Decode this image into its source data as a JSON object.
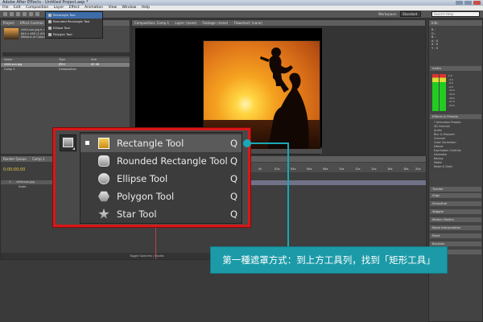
{
  "window": {
    "title": "Adobe After Effects - Untitled Project.aep *"
  },
  "menu": [
    "File",
    "Edit",
    "Composition",
    "Layer",
    "Effect",
    "Animation",
    "View",
    "Window",
    "Help"
  ],
  "toolbar": {
    "workspace_label": "Workspace:",
    "workspace_value": "Standard",
    "search_placeholder": "Search Help"
  },
  "project_panel": {
    "tabs": [
      "Project",
      "Effect Controls"
    ],
    "file_name": "child-sun.jpg",
    "file_info": [
      "child-sun.jpg ▾, used",
      "640 x 480 (1.00)",
      "Millions of Colors"
    ],
    "columns": [
      "Name",
      "Type",
      "Size"
    ],
    "rows": [
      {
        "name": "child-sun.jpg",
        "type": "JPEG",
        "size": "89 KB",
        "selected": true
      },
      {
        "name": "Comp 1",
        "type": "Composition",
        "size": "",
        "selected": false
      }
    ]
  },
  "small_menu": {
    "items": [
      {
        "label": "Rectangle Tool",
        "highlight": true
      },
      {
        "label": "Rounded Rectangle Tool",
        "highlight": false
      },
      {
        "label": "Ellipse Tool",
        "highlight": false
      },
      {
        "label": "Polygon Tool",
        "highlight": false
      },
      {
        "label": "Star Tool",
        "highlight": false
      }
    ]
  },
  "composition_panel": {
    "tabs": [
      "Composition: Comp 1",
      "Layer: (none)",
      "Footage: (none)",
      "Flowchart: (none)"
    ]
  },
  "right_panels": {
    "info_lines": [
      "R :",
      "G :",
      "B :",
      "A : 0",
      "X : 0",
      "Y : 0"
    ],
    "audio_label": "Audio",
    "audio_ticks": [
      "0.0",
      "-3.0",
      "-6.0",
      "-9.0",
      "-12.0",
      "-15.0",
      "-18.0",
      "-21.0",
      "-24.0"
    ],
    "fx_head": "Effects & Presets",
    "fx_items": [
      "* Animation Presets",
      "3D Channel",
      "Audio",
      "Blur & Sharpen",
      "Channel",
      "Color Correction",
      "Distort",
      "Expression Controls",
      "Generate",
      "Keying",
      "Matte",
      "Noise & Grain"
    ],
    "bottom_heads": [
      "Tracker",
      "Align",
      "Smoother",
      "Wiggler",
      "Motion Sketch",
      "Mask Interpolation",
      "Paint",
      "Brushes",
      "Character"
    ]
  },
  "timeline": {
    "tabs": [
      "Render Queue",
      "Comp 1"
    ],
    "time": "0;00;00;00",
    "layers": [
      {
        "num": "1",
        "name": "child-sun.jpg",
        "selected": true
      },
      {
        "num": "",
        "name": "Scale",
        "selected": false
      }
    ],
    "ruler": [
      "0s",
      "02s",
      "04s",
      "06s",
      "08s",
      "10s",
      "12s",
      "14s",
      "16s",
      "18s",
      "20s"
    ],
    "footer": "Toggle Switches / Modes"
  },
  "tool_flyout": {
    "items": [
      {
        "label": "Rectangle Tool",
        "key": "Q",
        "icon": "rectangle-icon",
        "active": true
      },
      {
        "label": "Rounded Rectangle Tool",
        "key": "Q",
        "icon": "rounded-rectangle-icon",
        "active": false
      },
      {
        "label": "Ellipse Tool",
        "key": "Q",
        "icon": "ellipse-icon",
        "active": false
      },
      {
        "label": "Polygon Tool",
        "key": "Q",
        "icon": "polygon-icon",
        "active": false
      },
      {
        "label": "Star Tool",
        "key": "Q",
        "icon": "star-icon",
        "active": false
      }
    ]
  },
  "annotation": {
    "text": "第一種遮罩方式：到上方工具列，找到「矩形工具」"
  },
  "colors": {
    "callout_border": "#d71818",
    "annotation_bg": "#1c9aa8",
    "highlight": "#5a5a5a"
  }
}
